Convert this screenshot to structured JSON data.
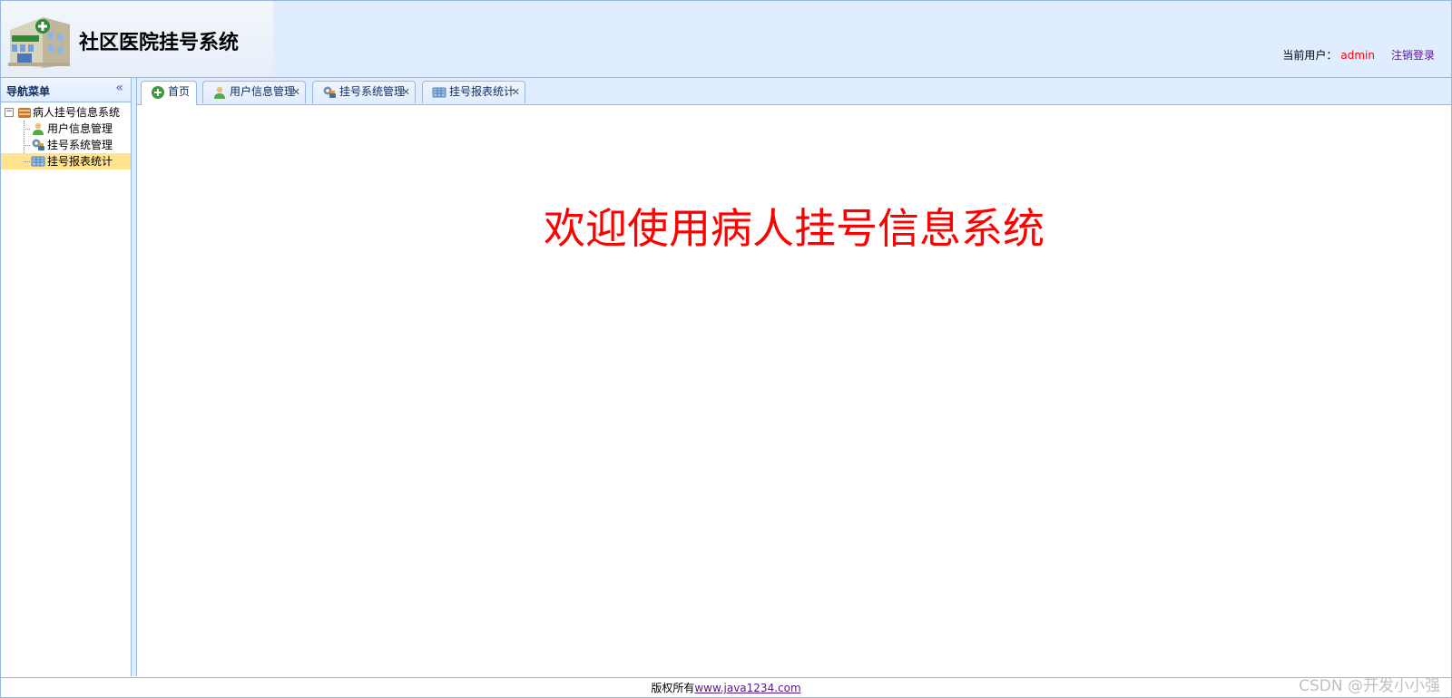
{
  "header": {
    "title": "社区医院挂号系统",
    "user_label": "当前用户：",
    "username": "admin",
    "logout": "注销登录"
  },
  "nav": {
    "title": "导航菜单",
    "collapse_icon": "double-chevron-left-icon",
    "root": {
      "label": "病人挂号信息系统",
      "icon": "database-icon",
      "expanded": true
    },
    "items": [
      {
        "label": "用户信息管理",
        "icon": "user-icon",
        "selected": false
      },
      {
        "label": "挂号系统管理",
        "icon": "tools-icon",
        "selected": false
      },
      {
        "label": "挂号报表统计",
        "icon": "report-icon",
        "selected": true
      }
    ]
  },
  "tabs": [
    {
      "label": "首页",
      "icon": "home-plus-icon",
      "active": true,
      "closable": false
    },
    {
      "label": "用户信息管理",
      "icon": "user-icon",
      "active": false,
      "closable": true
    },
    {
      "label": "挂号系统管理",
      "icon": "tools-icon",
      "active": false,
      "closable": true
    },
    {
      "label": "挂号报表统计",
      "icon": "report-icon",
      "active": false,
      "closable": true
    }
  ],
  "main": {
    "welcome": "欢迎使用病人挂号信息系统"
  },
  "footer": {
    "copyright": "版权所有",
    "link": "www.java1234.com"
  },
  "watermark": "CSDN @开发小小强",
  "colors": {
    "panel_bg": "#e0ecff",
    "border": "#95b8e7",
    "welcome_text": "#ff0000",
    "selected_node": "#ffe48d",
    "username": "#ff0000"
  }
}
